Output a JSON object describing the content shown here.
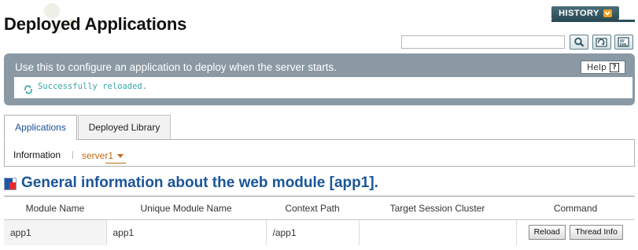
{
  "page": {
    "title": "Deployed Applications",
    "history_label": "HISTORY"
  },
  "toolbar": {
    "search_value": "",
    "icons": [
      "search-icon",
      "reload-icon",
      "xml-icon"
    ]
  },
  "info": {
    "description": "Use this to configure an application to deploy when the server starts.",
    "help_label": "Help",
    "help_glyph": "?",
    "status_message": "Successfully reloaded."
  },
  "tabs": [
    {
      "label": "Applications",
      "active": true
    },
    {
      "label": "Deployed Library",
      "active": false
    }
  ],
  "subnav": {
    "label": "Information",
    "server_selected": "server1"
  },
  "section": {
    "title": "General information about the web module [app1]."
  },
  "table": {
    "headers": [
      "Module Name",
      "Unique Module Name",
      "Context Path",
      "Target Session Cluster",
      "Command"
    ],
    "rows": [
      {
        "module_name": "app1",
        "unique_module_name": "app1",
        "context_path": "/app1",
        "target_session_cluster": "",
        "commands": [
          "Reload",
          "Thread Info"
        ]
      }
    ]
  },
  "colors": {
    "accent_blue": "#1b5598",
    "panel_gray": "#8a99a4",
    "status_teal": "#3aa6a8",
    "select_orange": "#c26a12"
  }
}
